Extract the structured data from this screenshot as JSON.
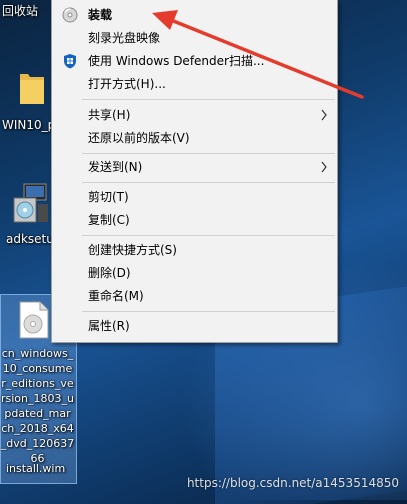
{
  "desktop": {
    "icons": [
      {
        "label": "回收站"
      },
      {
        "label": "WIN10_p"
      },
      {
        "label": "adksetu"
      }
    ],
    "selected_file": {
      "lines": [
        "cn_windows_",
        "10_consume",
        "r_editions_ve",
        "rsion_1803_u",
        "pdated_mar",
        "ch_2018_x64",
        "_dvd_120637",
        "66"
      ],
      "drag_label": "install.wim"
    }
  },
  "context_menu": {
    "items": [
      {
        "label": "装载",
        "bold": true,
        "icon": "disc-mount-icon"
      },
      {
        "label": "刻录光盘映像"
      },
      {
        "label": "使用 Windows Defender扫描...",
        "icon": "windows-defender-icon"
      },
      {
        "label": "打开方式(H)..."
      },
      {
        "label": "共享(H)",
        "submenu": true
      },
      {
        "label": "还原以前的版本(V)"
      },
      {
        "label": "发送到(N)",
        "submenu": true
      },
      {
        "label": "剪切(T)"
      },
      {
        "label": "复制(C)"
      },
      {
        "label": "创建快捷方式(S)"
      },
      {
        "label": "删除(D)"
      },
      {
        "label": "重命名(M)"
      },
      {
        "label": "属性(R)"
      }
    ]
  },
  "watermark": "https://blog.csdn.net/a1453514850",
  "colors": {
    "menu_bg": "#f2f2f2",
    "annotation_arrow": "#e53b2c",
    "desktop_bg": "#0f3a68"
  }
}
